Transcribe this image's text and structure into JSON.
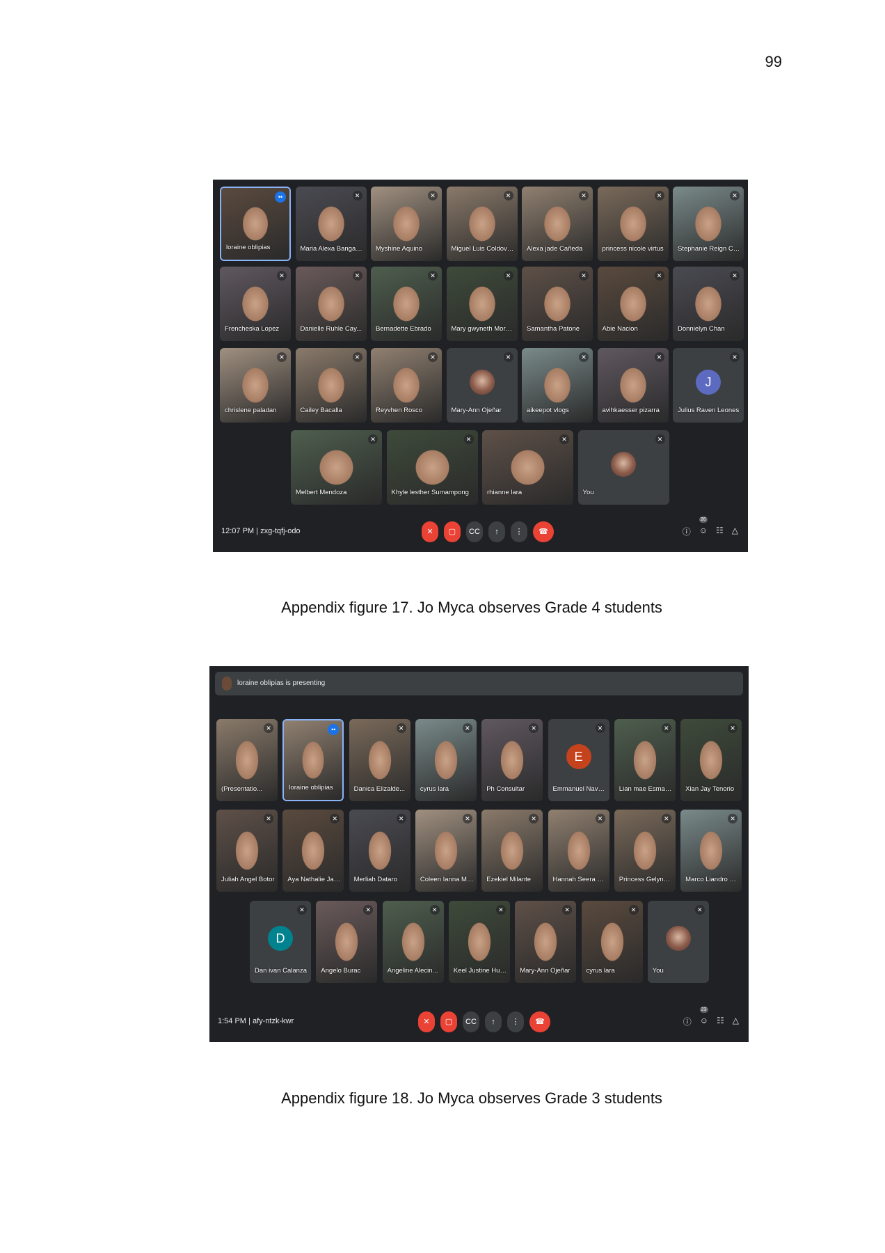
{
  "page_number": "99",
  "figures": [
    {
      "caption": "Appendix figure 17. Jo Myca observes Grade 4 students",
      "meeting_time": "12:07 PM",
      "meeting_code": "zxg-tqfj-odo",
      "participant_count": "26",
      "presenting_banner": "",
      "participants": [
        "loraine oblipias",
        "Maria Alexa Bangayan",
        "Myshine Aquino",
        "Miguel Luis Coldovero",
        "Alexa jade Cañeda",
        "princess nicole virtus",
        "Stephanie Reign Cali...",
        "Frencheska Lopez",
        "Danielle Ruhle Cay...",
        "Bernadette Ebrado",
        "Mary gwyneth Morali...",
        "Samantha Patone",
        "Abie Nacion",
        "Donnielyn Chan",
        "chrislene paladan",
        "Cailey Bacalla",
        "Reyvhen Rosco",
        "Mary-Ann Ojeñar",
        "aikeepot vlogs",
        "avihkaesser pizarra",
        "Julius Raven Leones",
        "Melbert Mendoza",
        "Khyle lesther Sumampong",
        "rhianne lara",
        "You"
      ],
      "avatars": {
        "Mary-Ann Ojeñar": "",
        "Julius Raven Leones": "J"
      }
    },
    {
      "caption": "Appendix figure 18. Jo Myca observes Grade 3 students",
      "meeting_time": "1:54 PM",
      "meeting_code": "afy-ntzk-kwr",
      "participant_count": "23",
      "presenting_banner": "loraine oblipias is presenting",
      "participants": [
        "(Presentatio...",
        "loraine oblipias",
        "Danica Elizalde...",
        "cyrus lara",
        "Ph Consultar",
        "Emmanuel Navarr...",
        "Lian mae Esmari...",
        "Xian Jay Tenorio",
        "Juliah Angel Botor",
        "Aya Nathalie Jan...",
        "Merliah Dataro",
        "Coleen Ianna Mo...",
        "Ezekiel Milante",
        "Hannah Seera M...",
        "Princess Gelyne...",
        "Marco Liandro Col...",
        "Dan ivan Calanza",
        "Angelo Burac",
        "Angeline Alecin...",
        "Keel Justine Hural",
        "Mary-Ann Ojeñar",
        "cyrus lara",
        "You"
      ],
      "avatars": {
        "Emmanuel Navarr...": "E",
        "Dan ivan Calanza": "D"
      }
    }
  ],
  "colors": {
    "meet_bg": "#202124",
    "tile_bg": "#3c4043",
    "end_call": "#ea4335",
    "active_speaker": "#8ab4f8"
  },
  "icons": [
    "mic-off-icon",
    "camera-off-icon",
    "captions-icon",
    "present-icon",
    "more-icon",
    "end-call-icon",
    "info-icon",
    "people-icon",
    "chat-icon",
    "activities-icon"
  ]
}
